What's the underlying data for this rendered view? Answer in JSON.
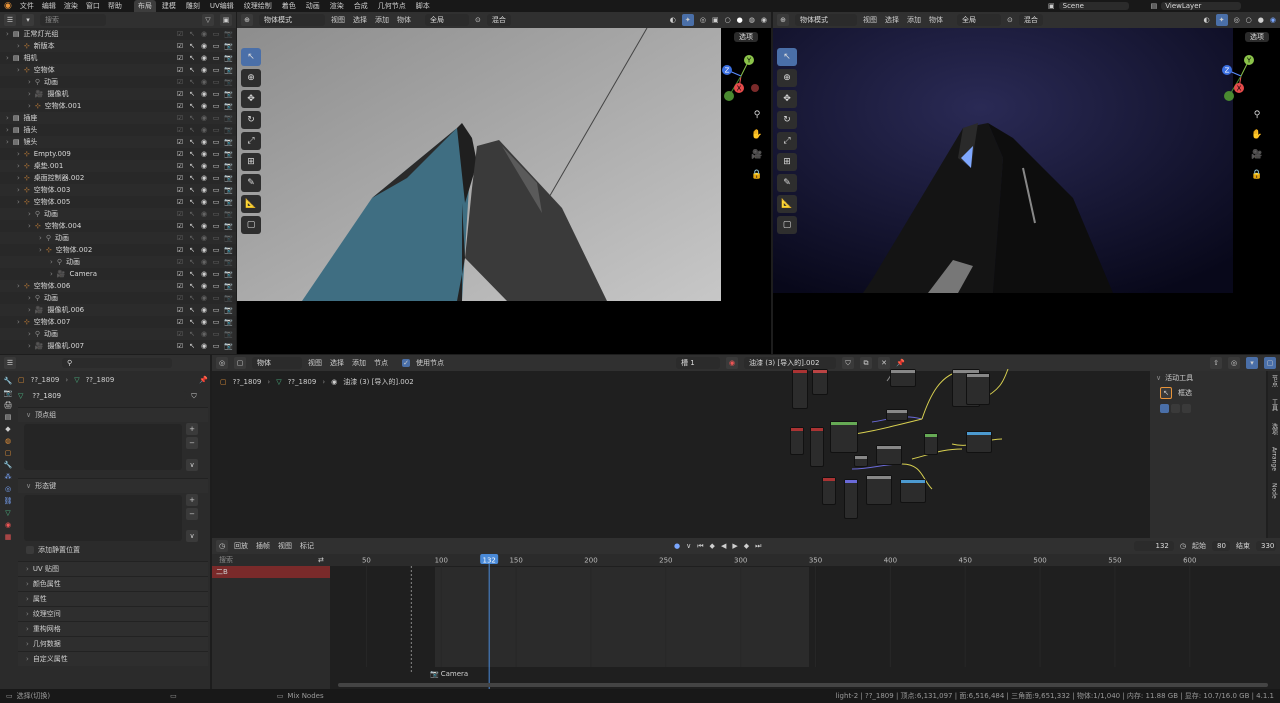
{
  "topbar": {
    "menus": [
      "文件",
      "编辑",
      "渲染",
      "窗口",
      "帮助"
    ],
    "workspaces": [
      "布局",
      "建模",
      "雕刻",
      "UV编辑",
      "纹理绘制",
      "着色",
      "动画",
      "渲染",
      "合成",
      "几何节点",
      "脚本"
    ],
    "active_workspace": "布局",
    "scene": "Scene",
    "view_layer": "ViewLayer"
  },
  "outliner": {
    "search_placeholder": "搜索",
    "rows": [
      {
        "indent": 0,
        "label": "正常灯光组",
        "dim": true
      },
      {
        "indent": 1,
        "label": "新版本",
        "vis": true
      },
      {
        "indent": 0,
        "label": "相机",
        "vis": true
      },
      {
        "indent": 1,
        "label": "空物体",
        "vis": true
      },
      {
        "indent": 2,
        "label": "动画"
      },
      {
        "indent": 2,
        "label": "摄像机",
        "vis": true
      },
      {
        "indent": 2,
        "label": "空物体.001",
        "vis": true
      },
      {
        "indent": 0,
        "label": "插座",
        "dim": true
      },
      {
        "indent": 0,
        "label": "插头",
        "dim": true
      },
      {
        "indent": 0,
        "label": "镜头",
        "vis": true
      },
      {
        "indent": 1,
        "label": "Empty.009",
        "vis": true
      },
      {
        "indent": 1,
        "label": "桌垫.001",
        "vis": true
      },
      {
        "indent": 1,
        "label": "桌面控制器.002",
        "vis": true
      },
      {
        "indent": 1,
        "label": "空物体.003",
        "vis": true
      },
      {
        "indent": 1,
        "label": "空物体.005",
        "vis": true
      },
      {
        "indent": 2,
        "label": "动画"
      },
      {
        "indent": 2,
        "label": "空物体.004",
        "vis": true
      },
      {
        "indent": 3,
        "label": "动画"
      },
      {
        "indent": 3,
        "label": "空物体.002",
        "vis": true
      },
      {
        "indent": 4,
        "label": "动画"
      },
      {
        "indent": 4,
        "label": "Camera",
        "vis": true
      },
      {
        "indent": 1,
        "label": "空物体.006",
        "vis": true
      },
      {
        "indent": 2,
        "label": "动画"
      },
      {
        "indent": 2,
        "label": "摄像机.006",
        "vis": true
      },
      {
        "indent": 1,
        "label": "空物体.007",
        "vis": true
      },
      {
        "indent": 2,
        "label": "动画"
      },
      {
        "indent": 2,
        "label": "摄像机.007",
        "vis": true
      }
    ]
  },
  "viewport_left": {
    "mode": "物体模式",
    "menus": [
      "视图",
      "选择",
      "添加",
      "物体"
    ],
    "transform": "全局",
    "blend": "混合",
    "options": "选项"
  },
  "viewport_right": {
    "mode": "物体模式",
    "menus": [
      "视图",
      "选择",
      "添加",
      "物体"
    ],
    "transform": "全局",
    "blend": "混合",
    "options": "选项"
  },
  "gizmo": {
    "x": "X",
    "y": "Y",
    "z": "Z"
  },
  "properties": {
    "object_name": "??_1809",
    "mesh_name": "??_1809",
    "data_name": "??_1809",
    "vertex_groups": "顶点组",
    "shape_keys": "形态键",
    "add_rest": "添加静置位置",
    "sections": [
      "UV 贴图",
      "颜色属性",
      "属性",
      "纹理空间",
      "重构网格",
      "几何数据",
      "自定义属性"
    ]
  },
  "node_editor": {
    "type": "物体",
    "menus": [
      "视图",
      "选择",
      "添加",
      "节点"
    ],
    "use_nodes": "使用节点",
    "slot": "槽 1",
    "material": "油漆 (3) [导入的].002",
    "breadcrumb": [
      "??_1809",
      "??_1809",
      "油漆 (3) [导入的].002"
    ],
    "side_title": "活动工具",
    "side_tool": "框选",
    "side_tabs": [
      "节点",
      "工具",
      "选项",
      "Arrange",
      "Node"
    ]
  },
  "timeline": {
    "menus": [
      "回放",
      "插帧",
      "视图",
      "标记"
    ],
    "current_frame": "132",
    "start_label": "起始",
    "start": "80",
    "end_label": "结束",
    "end": "330",
    "search_placeholder": "搜索",
    "channel": "二B",
    "ticks": [
      "50",
      "100",
      "132",
      "150",
      "200",
      "250",
      "300",
      "350",
      "400",
      "450",
      "500",
      "550",
      "600"
    ],
    "marker": "Camera"
  },
  "status": {
    "left": "选择(切换)",
    "middle": "Mix Nodes",
    "right": "light-2 | ??_1809 | 顶点:6,131,097 | 面:6,516,484 | 三角面:9,651,332 | 物体:1/1,040 | 内存: 11.88 GB | 显存: 10.7/16.0 GB | 4.1.1"
  }
}
